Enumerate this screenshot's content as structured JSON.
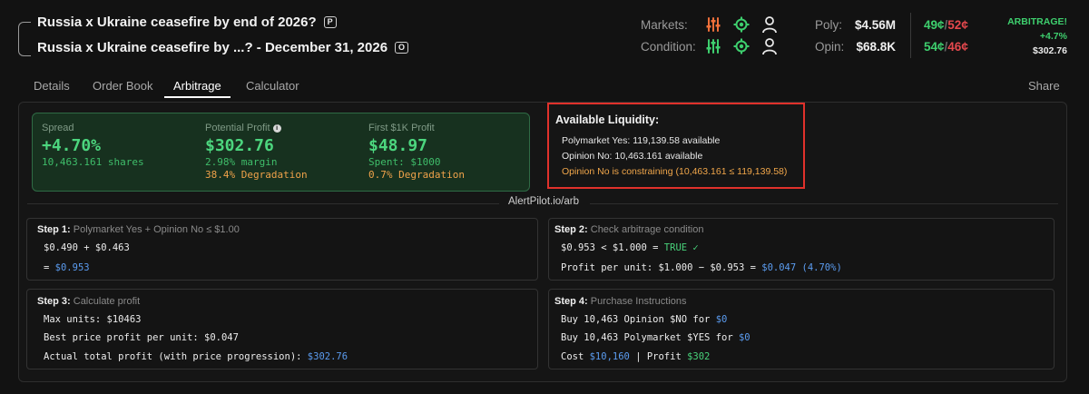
{
  "header": {
    "title_1": "Russia x Ukraine ceasefire by end of 2026?",
    "tag_1": "P",
    "title_2": "Russia x Ukraine ceasefire by ...? - December 31, 2026",
    "tag_2": "O",
    "markets_label": "Markets:",
    "condition_label": "Condition:",
    "poly_label": "Poly:",
    "poly_value": "$4.56M",
    "opin_label": "Opin:",
    "opin_value": "$68.8K",
    "poly_yes": "49¢",
    "poly_no": "52¢",
    "opin_yes": "54¢",
    "opin_no": "46¢",
    "slash": "/",
    "arb_label": "ARBITRAGE!",
    "arb_pct": "+4.7%",
    "arb_profit": "$302.76"
  },
  "tabs": [
    "Details",
    "Order Book",
    "Arbitrage",
    "Calculator"
  ],
  "share_label": "Share",
  "summary": {
    "spread_label": "Spread",
    "spread_value": "+4.70%",
    "spread_sub": "10,463.161 shares",
    "profit_label": "Potential Profit",
    "profit_value": "$302.76",
    "profit_margin": "2.98% margin",
    "profit_degradation": "38.4% Degradation",
    "first_label": "First $1K Profit",
    "first_value": "$48.97",
    "first_spent": "Spent: $1000",
    "first_degradation": "0.7% Degradation"
  },
  "liquidity": {
    "title": "Available Liquidity:",
    "line1": "Polymarket Yes: 119,139.58 available",
    "line2": "Opinion No: 10,463.161 available",
    "warning": "Opinion No is constraining (10,463.161 ≤ 119,139.58)"
  },
  "watermark": "AlertPilot.io/arb",
  "step1": {
    "label": "Step 1:",
    "desc": "Polymarket Yes + Opinion No ≤ $1.00",
    "line1": "$0.490 + $0.463",
    "line2_prefix": "= ",
    "line2_value": "$0.953"
  },
  "step2": {
    "label": "Step 2:",
    "desc": "Check arbitrage condition",
    "line1_prefix": "$0.953 < $1.000 = ",
    "line1_value": "TRUE ✓",
    "line2_prefix": "Profit per unit: $1.000 − $0.953 = ",
    "line2_value": "$0.047 (4.70%)"
  },
  "step3": {
    "label": "Step 3:",
    "desc": "Calculate profit",
    "line1": "Max units: $10463",
    "line2": "Best price profit per unit: $0.047",
    "line3_prefix": "Actual total profit (with price progression): ",
    "line3_value": "$302.76"
  },
  "step4": {
    "label": "Step 4:",
    "desc": "Purchase Instructions",
    "line1_prefix": "Buy 10,463 Opinion $NO for ",
    "line1_value": "$0",
    "line2_prefix": "Buy 10,463 Polymarket $YES for ",
    "line2_value": "$0",
    "line3_a": "Cost ",
    "line3_cost": "$10,160",
    "line3_sep": " | Profit ",
    "line3_profit": "$302"
  },
  "colors": {
    "accent_green": "#3ecf6e",
    "accent_red": "#e5484d",
    "accent_blue": "#5b9cf0",
    "warning_orange": "#f0a64a",
    "icon_orange": "#f0703a",
    "highlight_border": "#e0312b"
  },
  "icons": [
    "sliders-icon",
    "crosshair-icon",
    "user-icon",
    "info-icon"
  ]
}
